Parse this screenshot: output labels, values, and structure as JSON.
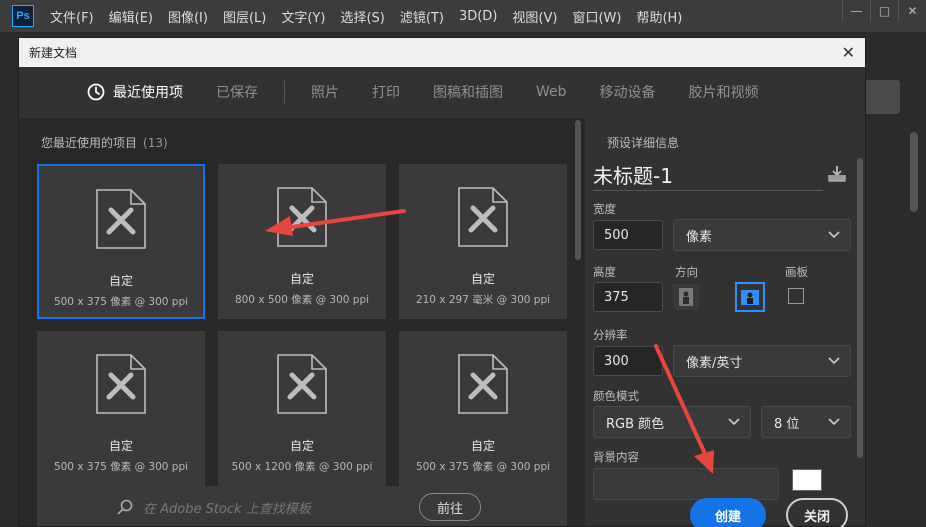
{
  "app": {
    "logo": "Ps",
    "menu": [
      "文件(F)",
      "编辑(E)",
      "图像(I)",
      "图层(L)",
      "文字(Y)",
      "选择(S)",
      "滤镜(T)",
      "3D(D)",
      "视图(V)",
      "窗口(W)",
      "帮助(H)"
    ],
    "window_controls": [
      "—",
      "□",
      "✕"
    ]
  },
  "dialog": {
    "title": "新建文档",
    "close_glyph": "✕",
    "tabs": [
      {
        "label": "最近使用项",
        "active": true,
        "icon": "clock-icon"
      },
      {
        "label": "已保存"
      },
      {
        "label": "照片"
      },
      {
        "label": "打印"
      },
      {
        "label": "图稿和插图"
      },
      {
        "label": "Web"
      },
      {
        "label": "移动设备"
      },
      {
        "label": "胶片和视频"
      }
    ],
    "recent": {
      "title": "您最近使用的项目",
      "count": "(13)",
      "cards": [
        {
          "name": "自定",
          "dims": "500 x 375 像素 @ 300 ppi",
          "selected": true
        },
        {
          "name": "自定",
          "dims": "800 x 500 像素 @ 300 ppi"
        },
        {
          "name": "自定",
          "dims": "210 x 297 毫米 @ 300 ppi"
        },
        {
          "name": "自定",
          "dims": "500 x 375 像素 @ 300 ppi"
        },
        {
          "name": "自定",
          "dims": "500 x 1200 像素 @ 300 ppi"
        },
        {
          "name": "自定",
          "dims": "500 x 375 像素 @ 300 ppi"
        }
      ]
    },
    "stock": {
      "placeholder": "在 Adobe Stock 上查找模板",
      "go_label": "前往"
    },
    "preset": {
      "header": "预设详细信息",
      "name": "未标题-1",
      "width_label": "宽度",
      "width_value": "500",
      "width_unit": "像素",
      "height_label": "高度",
      "height_value": "375",
      "orientation_label": "方向",
      "artboard_label": "画板",
      "resolution_label": "分辨率",
      "resolution_value": "300",
      "resolution_unit": "像素/英寸",
      "color_mode_label": "颜色模式",
      "color_mode": "RGB 颜色",
      "bit_depth": "8 位",
      "background_label": "背景内容"
    },
    "buttons": {
      "create": "创建",
      "close": "关闭"
    }
  },
  "colors": {
    "accent": "#1473e6",
    "annotation_arrow": "#e8453c"
  }
}
